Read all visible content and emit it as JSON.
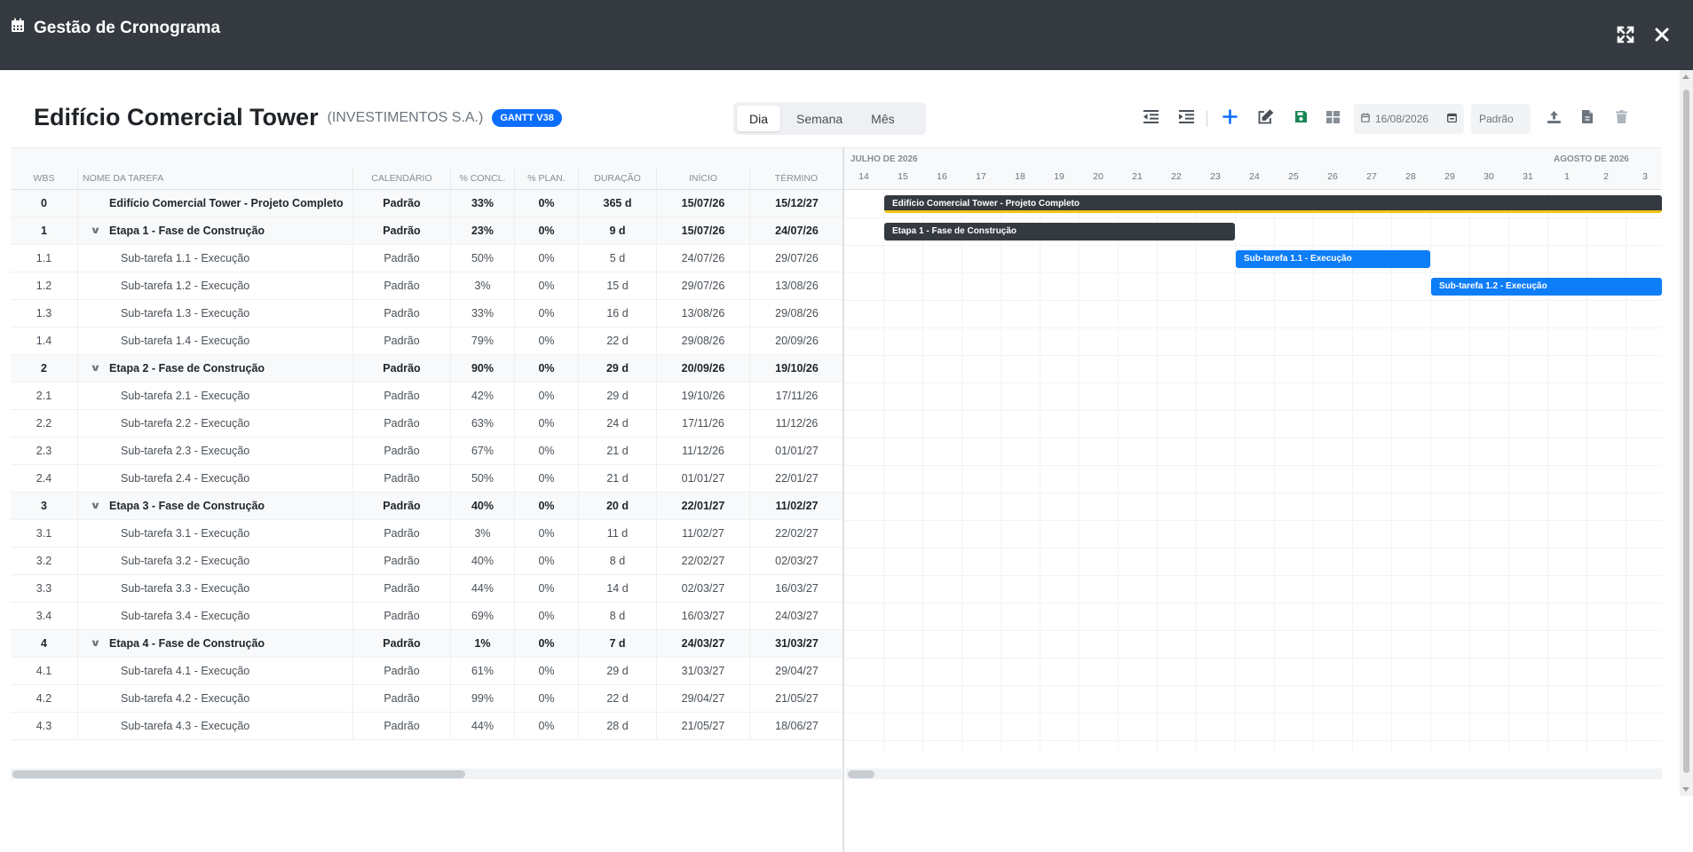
{
  "window": {
    "title": "Gestão de Cronograma"
  },
  "project": {
    "title": "Edifício Comercial Tower",
    "client": "(INVESTIMENTOS S.A.)",
    "badge": "GANTT V38"
  },
  "view_tabs": [
    {
      "label": "Dia",
      "active": true
    },
    {
      "label": "Semana",
      "active": false
    },
    {
      "label": "Mês",
      "active": false
    }
  ],
  "toolbar": {
    "date": "16/08/2026",
    "calendar": "Padrão"
  },
  "columns": {
    "wbs": "WBS",
    "name": "NOME DA TAREFA",
    "calendar": "CALENDÁRIO",
    "pct": "% CONCL.",
    "plan": "% PLAN.",
    "duration": "DURAÇÃO",
    "start": "INÍCIO",
    "end": "TÉRMINO"
  },
  "rows": [
    {
      "wbs": "0",
      "name": "Edifício Comercial Tower - Projeto Completo",
      "cal": "Padrão",
      "pct": "33%",
      "plan": "0%",
      "dur": "365 d",
      "start": "15/07/26",
      "end": "15/12/27",
      "level": 0
    },
    {
      "wbs": "1",
      "name": "Etapa 1 - Fase de Construção",
      "cal": "Padrão",
      "pct": "23%",
      "plan": "0%",
      "dur": "9 d",
      "start": "15/07/26",
      "end": "24/07/26",
      "level": 1
    },
    {
      "wbs": "1.1",
      "name": "Sub-tarefa 1.1 - Execução",
      "cal": "Padrão",
      "pct": "50%",
      "plan": "0%",
      "dur": "5 d",
      "start": "24/07/26",
      "end": "29/07/26",
      "level": 2
    },
    {
      "wbs": "1.2",
      "name": "Sub-tarefa 1.2 - Execução",
      "cal": "Padrão",
      "pct": "3%",
      "plan": "0%",
      "dur": "15 d",
      "start": "29/07/26",
      "end": "13/08/26",
      "level": 2
    },
    {
      "wbs": "1.3",
      "name": "Sub-tarefa 1.3 - Execução",
      "cal": "Padrão",
      "pct": "33%",
      "plan": "0%",
      "dur": "16 d",
      "start": "13/08/26",
      "end": "29/08/26",
      "level": 2
    },
    {
      "wbs": "1.4",
      "name": "Sub-tarefa 1.4 - Execução",
      "cal": "Padrão",
      "pct": "79%",
      "plan": "0%",
      "dur": "22 d",
      "start": "29/08/26",
      "end": "20/09/26",
      "level": 2
    },
    {
      "wbs": "2",
      "name": "Etapa 2 - Fase de Construção",
      "cal": "Padrão",
      "pct": "90%",
      "plan": "0%",
      "dur": "29 d",
      "start": "20/09/26",
      "end": "19/10/26",
      "level": 1
    },
    {
      "wbs": "2.1",
      "name": "Sub-tarefa 2.1 - Execução",
      "cal": "Padrão",
      "pct": "42%",
      "plan": "0%",
      "dur": "29 d",
      "start": "19/10/26",
      "end": "17/11/26",
      "level": 2
    },
    {
      "wbs": "2.2",
      "name": "Sub-tarefa 2.2 - Execução",
      "cal": "Padrão",
      "pct": "63%",
      "plan": "0%",
      "dur": "24 d",
      "start": "17/11/26",
      "end": "11/12/26",
      "level": 2
    },
    {
      "wbs": "2.3",
      "name": "Sub-tarefa 2.3 - Execução",
      "cal": "Padrão",
      "pct": "67%",
      "plan": "0%",
      "dur": "21 d",
      "start": "11/12/26",
      "end": "01/01/27",
      "level": 2
    },
    {
      "wbs": "2.4",
      "name": "Sub-tarefa 2.4 - Execução",
      "cal": "Padrão",
      "pct": "50%",
      "plan": "0%",
      "dur": "21 d",
      "start": "01/01/27",
      "end": "22/01/27",
      "level": 2
    },
    {
      "wbs": "3",
      "name": "Etapa 3 - Fase de Construção",
      "cal": "Padrão",
      "pct": "40%",
      "plan": "0%",
      "dur": "20 d",
      "start": "22/01/27",
      "end": "11/02/27",
      "level": 1
    },
    {
      "wbs": "3.1",
      "name": "Sub-tarefa 3.1 - Execução",
      "cal": "Padrão",
      "pct": "3%",
      "plan": "0%",
      "dur": "11 d",
      "start": "11/02/27",
      "end": "22/02/27",
      "level": 2
    },
    {
      "wbs": "3.2",
      "name": "Sub-tarefa 3.2 - Execução",
      "cal": "Padrão",
      "pct": "40%",
      "plan": "0%",
      "dur": "8 d",
      "start": "22/02/27",
      "end": "02/03/27",
      "level": 2
    },
    {
      "wbs": "3.3",
      "name": "Sub-tarefa 3.3 - Execução",
      "cal": "Padrão",
      "pct": "44%",
      "plan": "0%",
      "dur": "14 d",
      "start": "02/03/27",
      "end": "16/03/27",
      "level": 2
    },
    {
      "wbs": "3.4",
      "name": "Sub-tarefa 3.4 - Execução",
      "cal": "Padrão",
      "pct": "69%",
      "plan": "0%",
      "dur": "8 d",
      "start": "16/03/27",
      "end": "24/03/27",
      "level": 2
    },
    {
      "wbs": "4",
      "name": "Etapa 4 - Fase de Construção",
      "cal": "Padrão",
      "pct": "1%",
      "plan": "0%",
      "dur": "7 d",
      "start": "24/03/27",
      "end": "31/03/27",
      "level": 1
    },
    {
      "wbs": "4.1",
      "name": "Sub-tarefa 4.1 - Execução",
      "cal": "Padrão",
      "pct": "61%",
      "plan": "0%",
      "dur": "29 d",
      "start": "31/03/27",
      "end": "29/04/27",
      "level": 2
    },
    {
      "wbs": "4.2",
      "name": "Sub-tarefa 4.2 - Execução",
      "cal": "Padrão",
      "pct": "99%",
      "plan": "0%",
      "dur": "22 d",
      "start": "29/04/27",
      "end": "21/05/27",
      "level": 2
    },
    {
      "wbs": "4.3",
      "name": "Sub-tarefa 4.3 - Execução",
      "cal": "Padrão",
      "pct": "44%",
      "plan": "0%",
      "dur": "28 d",
      "start": "21/05/27",
      "end": "18/06/27",
      "level": 2
    }
  ],
  "timeline": {
    "months": [
      {
        "label": "JULHO DE 2026",
        "first_day_index": 0
      },
      {
        "label": "AGOSTO DE 2026",
        "first_day_index": 18
      }
    ],
    "days": [
      "14",
      "15",
      "16",
      "17",
      "18",
      "19",
      "20",
      "21",
      "22",
      "23",
      "24",
      "25",
      "26",
      "27",
      "28",
      "29",
      "30",
      "31",
      "1",
      "2",
      "3"
    ],
    "bars": [
      {
        "row": 0,
        "label": "Edifício Comercial Tower - Projeto Completo",
        "type": "summary",
        "start_index": 1,
        "end_index": 25,
        "baseline": true
      },
      {
        "row": 1,
        "label": "Etapa 1 - Fase de Construção",
        "type": "summary",
        "start_index": 1,
        "end_index": 10
      },
      {
        "row": 2,
        "label": "Sub-tarefa 1.1 - Execução",
        "type": "task",
        "start_index": 10,
        "end_index": 15
      },
      {
        "row": 3,
        "label": "Sub-tarefa 1.2 - Execução",
        "type": "task",
        "start_index": 15,
        "end_index": 25
      }
    ]
  },
  "colors": {
    "titlebar": "#343a40",
    "accent": "#0d6efd",
    "task_bar": "#0d7df8",
    "summary_bar": "#343a40",
    "baseline": "#f1c40f",
    "save": "#198754"
  }
}
